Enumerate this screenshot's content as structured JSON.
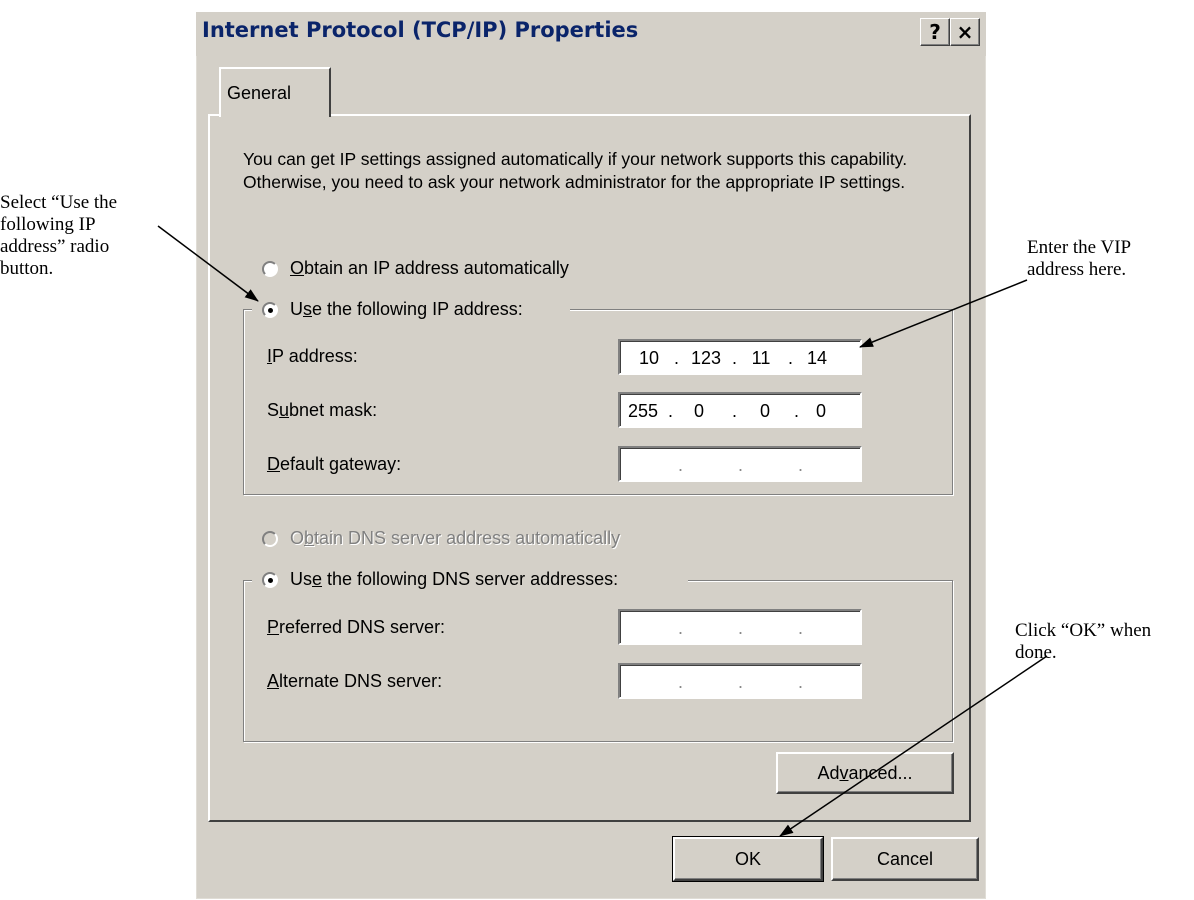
{
  "annotations": {
    "left": "Select “Use the\nfollowing IP\naddress” radio\nbutton.",
    "right_top": "Enter the VIP\naddress here.",
    "right_bottom": "Click “OK” when\ndone."
  },
  "dialog": {
    "title": "Internet Protocol (TCP/IP) Properties",
    "help_button": "?",
    "close_button": "×",
    "tab_label": "General",
    "description": "You can get IP settings assigned automatically if your network supports this capability. Otherwise, you need to ask your network administrator for the appropriate IP settings.",
    "radio_obtain_ip": {
      "pre": "",
      "key": "O",
      "post": "btain an IP address automatically",
      "selected": false
    },
    "radio_use_ip": {
      "pre": "U",
      "key": "s",
      "post": "e the following IP address:",
      "selected": true
    },
    "ip_address": {
      "pre": "",
      "key": "I",
      "post": "P address:",
      "octets": [
        "10",
        "123",
        "11",
        "14"
      ]
    },
    "subnet_mask": {
      "pre": "S",
      "key": "u",
      "post": "bnet mask:",
      "octets": [
        "255",
        "0",
        "0",
        "0"
      ]
    },
    "default_gateway": {
      "pre": "",
      "key": "D",
      "post": "efault gateway:",
      "octets": [
        "",
        "",
        "",
        ""
      ]
    },
    "radio_obtain_dns": {
      "pre": "O",
      "key": "b",
      "post": "tain DNS server address automatically",
      "selected": false,
      "disabled": true
    },
    "radio_use_dns": {
      "pre": "Us",
      "key": "e",
      "post": " the following DNS server addresses:",
      "selected": true
    },
    "preferred_dns": {
      "pre": "",
      "key": "P",
      "post": "referred DNS server:",
      "octets": [
        "",
        "",
        "",
        ""
      ]
    },
    "alternate_dns": {
      "pre": "",
      "key": "A",
      "post": "lternate DNS server:",
      "octets": [
        "",
        "",
        "",
        ""
      ]
    },
    "advanced_button": {
      "pre": "Ad",
      "key": "v",
      "post": "anced..."
    },
    "ok_button": "OK",
    "cancel_button": "Cancel"
  }
}
